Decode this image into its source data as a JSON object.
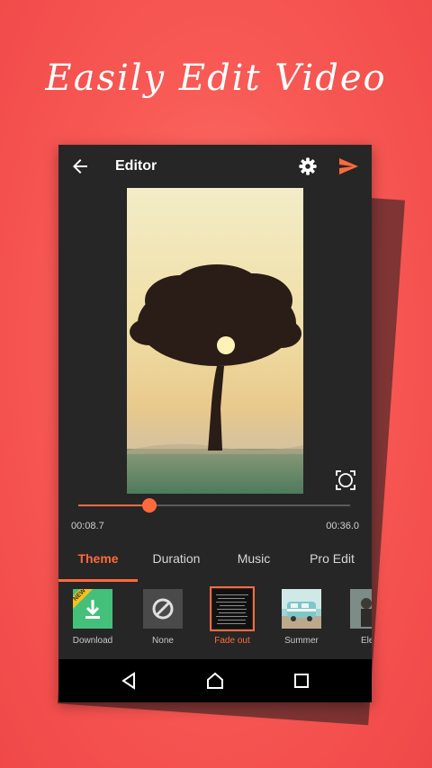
{
  "promo": {
    "title": "Easily Edit Video"
  },
  "toolbar": {
    "title": "Editor"
  },
  "playback": {
    "current_time": "00:08.7",
    "total_time": "00:36.0",
    "progress": 0.26
  },
  "tabs": [
    {
      "label": "Theme"
    },
    {
      "label": "Duration"
    },
    {
      "label": "Music"
    },
    {
      "label": "Pro Edit"
    }
  ],
  "themes": [
    {
      "label": "Download",
      "badge": "NEW"
    },
    {
      "label": "None"
    },
    {
      "label": "Fade out"
    },
    {
      "label": "Summer"
    },
    {
      "label": "Eleg"
    }
  ],
  "colors": {
    "accent": "#ff6a3d",
    "background": "#262626",
    "promo_bg": "#f85a55"
  }
}
